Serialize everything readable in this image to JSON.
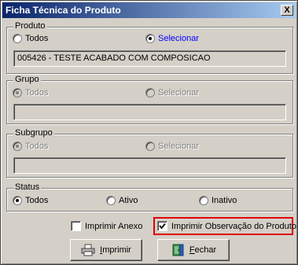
{
  "window": {
    "title": "Ficha Técnica do Produto",
    "close_glyph": "X"
  },
  "produto": {
    "label": "Produto",
    "opt_todos": "Todos",
    "opt_selecionar": "Selecionar",
    "selected": "Selecionar",
    "value": "005426 - TESTE ACABADO COM COMPOSICAO"
  },
  "grupo": {
    "label": "Grupo",
    "opt_todos": "Todos",
    "opt_selecionar": "Selecionar",
    "selected": "Todos",
    "value": ""
  },
  "subgrupo": {
    "label": "Subgrupo",
    "opt_todos": "Todos",
    "opt_selecionar": "Selecionar",
    "selected": "Todos",
    "value": ""
  },
  "status": {
    "label": "Status",
    "opt_todos": "Todos",
    "opt_ativo": "Ativo",
    "opt_inativo": "Inativo",
    "selected": "Todos"
  },
  "options": {
    "imprimir_anexo": {
      "label": "Imprimir Anexo",
      "checked": false
    },
    "imprimir_observacao": {
      "label": "Imprimir Observação do Produto",
      "checked": true
    }
  },
  "buttons": {
    "imprimir": {
      "accel": "I",
      "rest": "mprimir",
      "icon": "printer-icon"
    },
    "fechar": {
      "accel": "F",
      "rest": "echar",
      "icon": "exit-door-icon"
    }
  },
  "colors": {
    "title_start": "#0a246a",
    "title_end": "#a6caf0",
    "highlight": "#e00000",
    "selected_text": "#0000ff"
  }
}
